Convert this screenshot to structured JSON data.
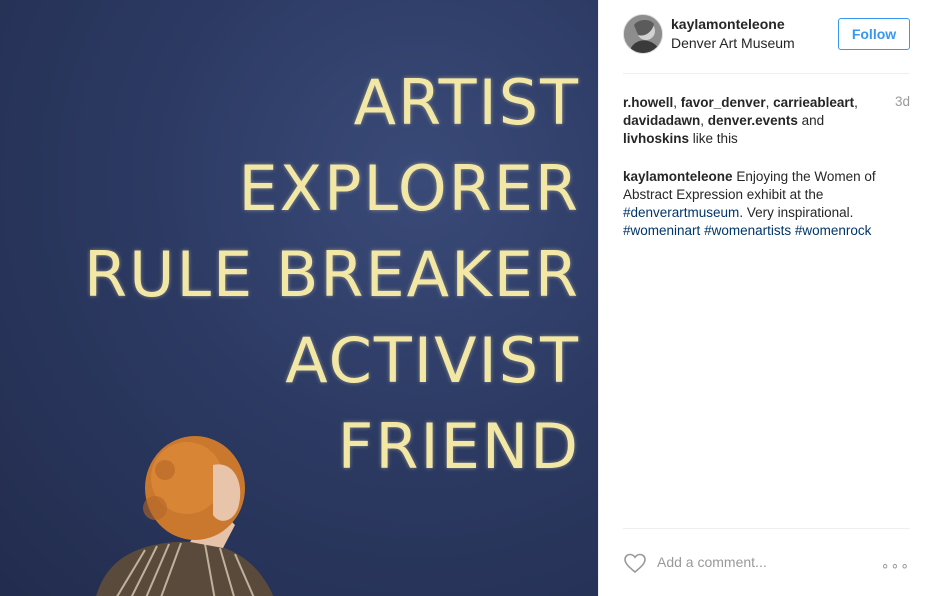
{
  "photo": {
    "wall_lines": [
      "ARTIST",
      "EXPLORER",
      "RULE BREAKER",
      "ACTIVIST",
      "FRIEND"
    ]
  },
  "header": {
    "username": "kaylamonteleone",
    "location": "Denver Art Museum",
    "follow_label": "Follow"
  },
  "likes": {
    "users": [
      "r.howell",
      "favor_denver",
      "carrieableart",
      "davidadawn",
      "denver.events",
      "livhoskins"
    ],
    "suffix": "like this",
    "and": "and",
    "time": "3d"
  },
  "caption": {
    "username": "kaylamonteleone",
    "text1": "Enjoying the Women of Abstract Expression exhibit at the",
    "tag1": "#denverartmuseum",
    "text2": ". Very inspirational.",
    "tag2": "#womeninart",
    "tag3": "#womenartists",
    "tag4": "#womenrock"
  },
  "comment": {
    "placeholder": "Add a comment...",
    "more": "∘∘∘"
  },
  "icons": {
    "heart": "heart-icon",
    "more": "more-options-icon"
  },
  "colors": {
    "accent": "#3897f0",
    "hashtag": "#003569",
    "wall_text": "#f3e7a6",
    "wall": "#2c3a63"
  }
}
